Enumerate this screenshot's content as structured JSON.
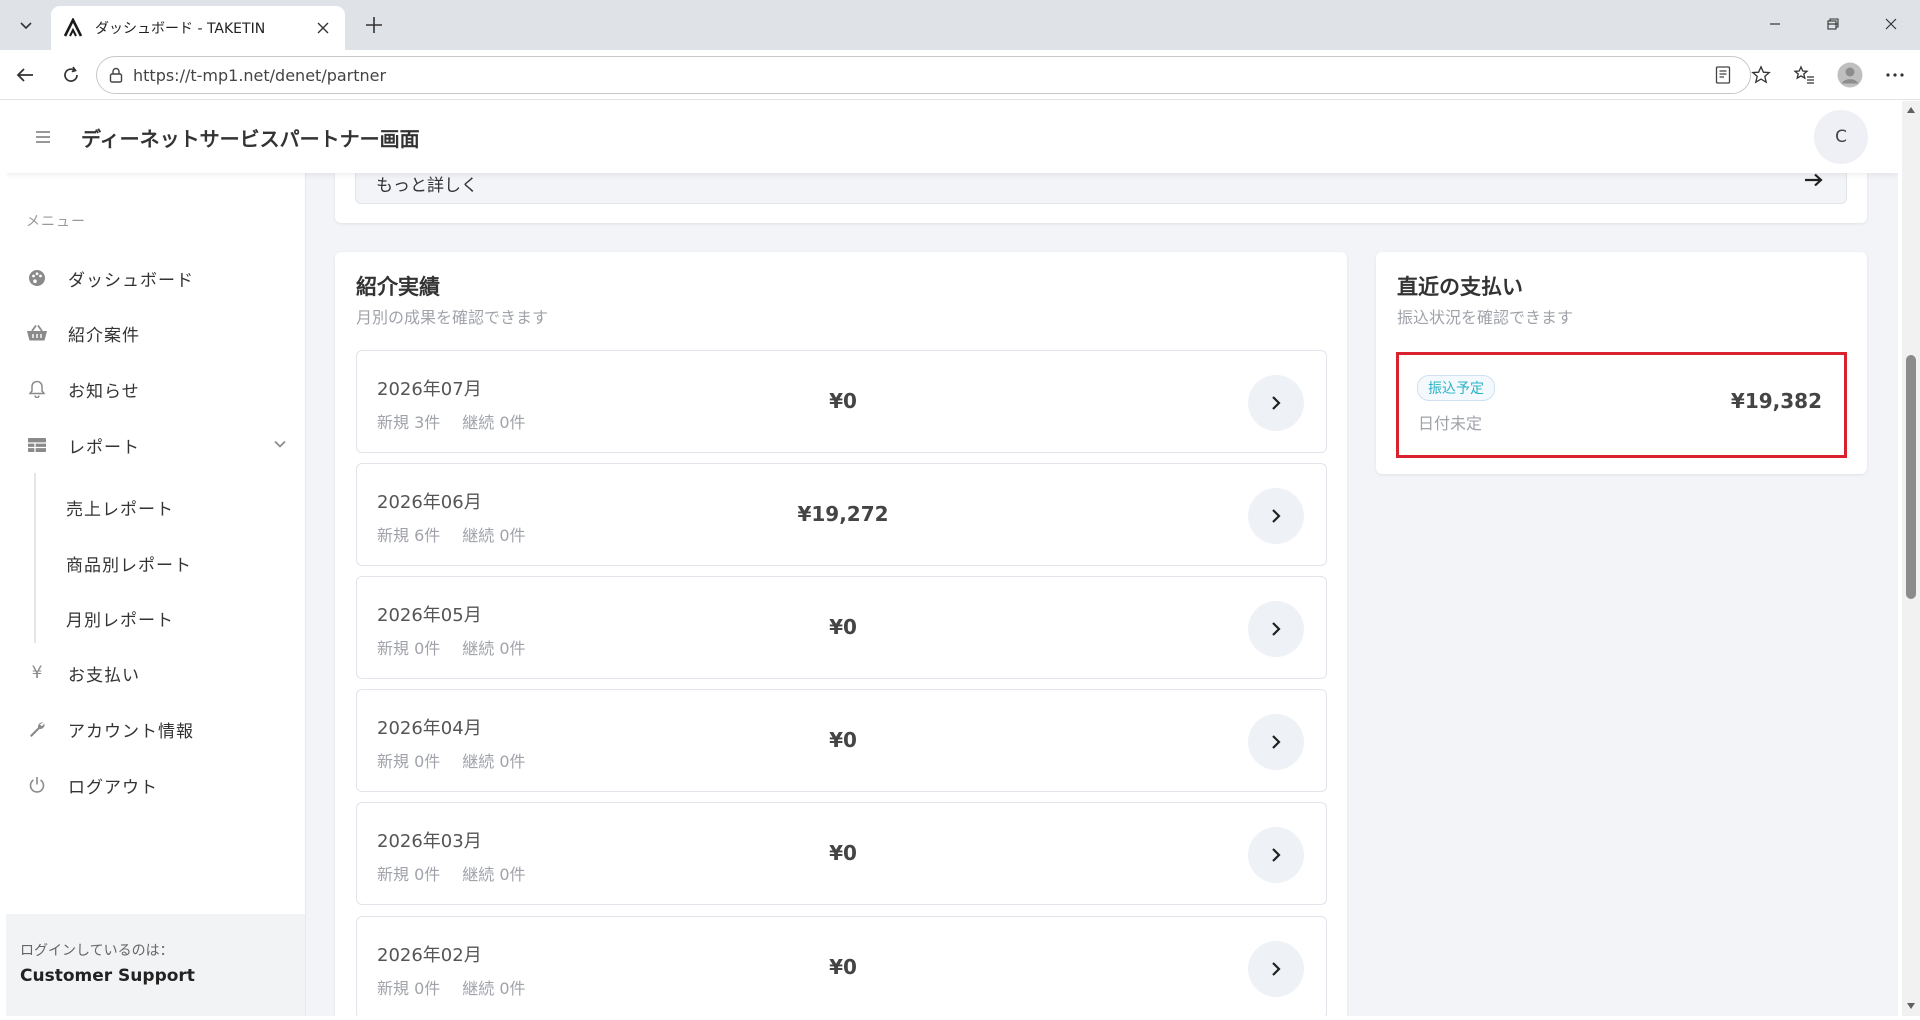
{
  "browser": {
    "tab_title": "ダッシュボード - TAKETIN",
    "url": "https://t-mp1.net/denet/partner"
  },
  "header": {
    "title": "ディーネットサービスパートナー画面",
    "avatar_initial": "C"
  },
  "sidebar": {
    "menu_heading": "メニュー",
    "items": [
      {
        "label": "ダッシュボード",
        "icon": "palette-icon"
      },
      {
        "label": "紹介案件",
        "icon": "basket-icon"
      },
      {
        "label": "お知らせ",
        "icon": "bell-icon"
      },
      {
        "label": "レポート",
        "icon": "table-icon"
      },
      {
        "label": "お支払い",
        "icon": "yen-icon"
      },
      {
        "label": "アカウント情報",
        "icon": "wrench-icon"
      },
      {
        "label": "ログアウト",
        "icon": "power-icon"
      }
    ],
    "report_sub": [
      "売上レポート",
      "商品別レポート",
      "月別レポート"
    ],
    "login_caption": "ログインしているのは：",
    "login_user": "Customer Support"
  },
  "top_card": {
    "more_label": "もっと詳しく"
  },
  "results": {
    "title": "紹介実績",
    "subtitle": "月別の成果を確認できます",
    "rows": [
      {
        "month": "2026年07月",
        "new": "新規 3件",
        "cont": "継続 0件",
        "amount": "¥0"
      },
      {
        "month": "2026年06月",
        "new": "新規 6件",
        "cont": "継続 0件",
        "amount": "¥19,272"
      },
      {
        "month": "2026年05月",
        "new": "新規 0件",
        "cont": "継続 0件",
        "amount": "¥0"
      },
      {
        "month": "2026年04月",
        "new": "新規 0件",
        "cont": "継続 0件",
        "amount": "¥0"
      },
      {
        "month": "2026年03月",
        "new": "新規 0件",
        "cont": "継続 0件",
        "amount": "¥0"
      },
      {
        "month": "2026年02月",
        "new": "新規 0件",
        "cont": "継続 0件",
        "amount": "¥0"
      }
    ]
  },
  "payment": {
    "title": "直近の支払い",
    "subtitle": "振込状況を確認できます",
    "badge": "振込予定",
    "date": "日付未定",
    "amount": "¥19,382"
  },
  "colors": {
    "accent": "#2ab2c6",
    "highlight": "#d8232f",
    "page_bg": "#f2f4f8"
  }
}
